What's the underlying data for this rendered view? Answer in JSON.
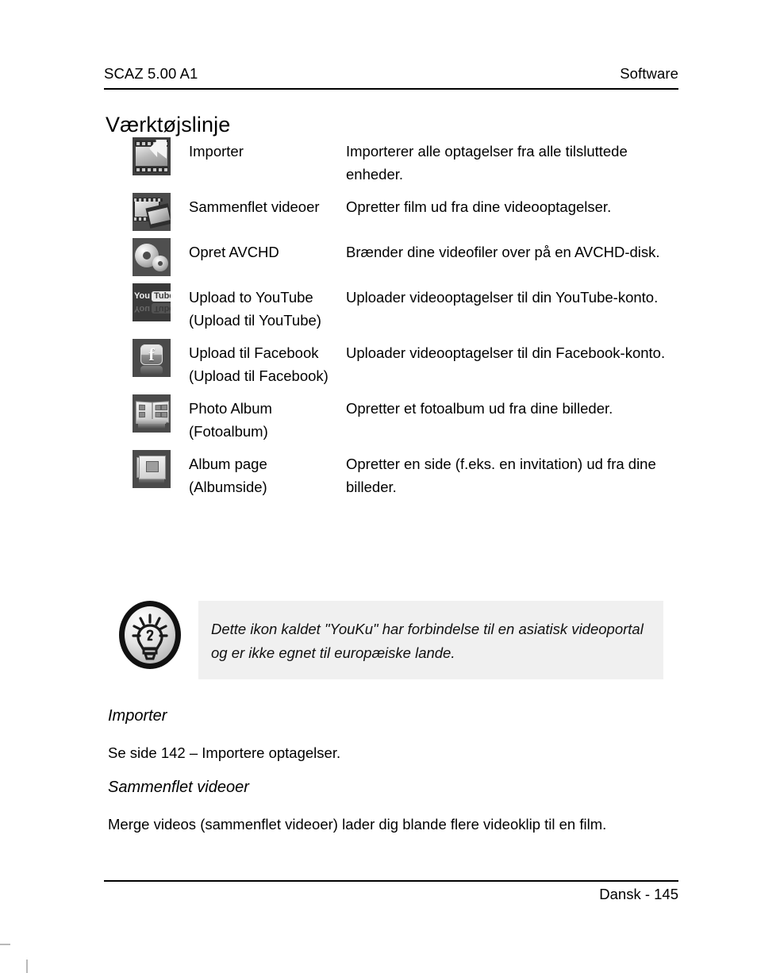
{
  "header": {
    "left": "SCAZ 5.00 A1",
    "right": "Software"
  },
  "title": "Værktøjslinje",
  "toolbar_table": {
    "rows": [
      {
        "icon": "import-film-arrow-icon",
        "name": "Importer",
        "description": "Importerer alle optagelser fra alle tilsluttede enheder."
      },
      {
        "icon": "merge-videos-filmstrips-icon",
        "name": "Sammenflet videoer",
        "description": "Opretter film ud fra dine videooptagelser."
      },
      {
        "icon": "avchd-discs-icon",
        "name": "Opret AVCHD",
        "description": "Brænder dine videofiler over på en AVCHD-disk."
      },
      {
        "icon": "youtube-icon",
        "name": "Upload to YouTube (Upload til YouTube)",
        "description": "Uploader videooptagelser til din YouTube-konto."
      },
      {
        "icon": "facebook-icon",
        "name": "Upload til Facebook (Upload til Facebook)",
        "description": "Uploader videooptagelser til din Facebook-konto."
      },
      {
        "icon": "photo-album-book-icon",
        "name": "Photo Album (Fotoalbum)",
        "description": "Opretter et fotoalbum ud fra dine billeder."
      },
      {
        "icon": "album-page-icon",
        "name": "Album page (Albumside)",
        "description": "Opretter en side (f.eks. en invitation) ud fra dine billeder."
      }
    ]
  },
  "note": {
    "icon": "lightbulb-tip-icon",
    "text": "Dette ikon kaldet \"YouKu\" har forbindelse til en asiatisk videoportal og er ikke egnet til europæiske lande."
  },
  "sections": [
    {
      "heading": "Importer",
      "paragraph": "Se side 142 – Importere optagelser."
    },
    {
      "heading": "Sammenflet videoer",
      "paragraph": "Merge videos (sammenflet videoer) lader dig blande flere videoklip til en film."
    }
  ],
  "footer": {
    "text": "Dansk - 145"
  },
  "colors": {
    "page_background": "#ffffff",
    "text": "#000000",
    "note_box_background": "#f0f0f0",
    "rule": "#000000"
  }
}
